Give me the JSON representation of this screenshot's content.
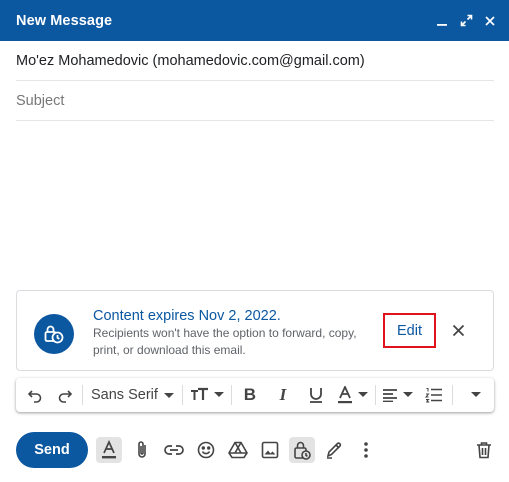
{
  "window": {
    "title": "New Message",
    "controls": [
      "minimize-icon",
      "expand-icon",
      "close-icon"
    ]
  },
  "recipients": {
    "to_text": "Mo'ez Mohamedovic (mohamedovic.com@gmail.com)"
  },
  "subject": {
    "placeholder": "Subject",
    "value": ""
  },
  "confidential_banner": {
    "headline": "Content expires Nov 2, 2022.",
    "description": "Recipients won't have the option to forward, copy, print, or download this email.",
    "edit_label": "Edit",
    "icon": "clock-lock-icon"
  },
  "formatting": {
    "font": "Sans Serif",
    "tools": [
      "undo-icon",
      "redo-icon",
      "font-select",
      "text-size-icon",
      "bold-icon",
      "italic-icon",
      "underline-icon",
      "text-color-icon",
      "align-icon",
      "numbered-list-icon",
      "more-formatting-icon"
    ]
  },
  "bottom_toolbar": {
    "send_label": "Send",
    "tools": [
      "formatting-options-icon",
      "attach-icon",
      "link-icon",
      "emoji-icon",
      "drive-icon",
      "photo-icon",
      "confidential-mode-icon",
      "signature-icon",
      "more-options-icon",
      "discard-icon"
    ]
  },
  "colors": {
    "primary": "#0b57a0",
    "highlight_border": "#e0131c"
  }
}
